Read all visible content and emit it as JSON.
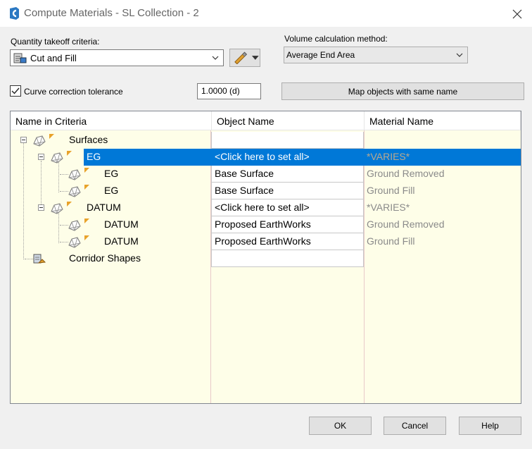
{
  "window": {
    "title": "Compute Materials - SL Collection - 2",
    "app_icon": "civil3d-logo-icon",
    "close_icon": "close-icon"
  },
  "criteria": {
    "label": "Quantity takeoff criteria:",
    "value": "Cut and Fill",
    "edit_icon": "edit-criteria-icon"
  },
  "volume": {
    "label": "Volume calculation method:",
    "value": "Average End Area"
  },
  "curve": {
    "label": "Curve correction tolerance",
    "checked": true,
    "value": "1.0000 (d)"
  },
  "map_button": "Map objects with same name",
  "grid": {
    "headers": [
      "Name in Criteria",
      "Object Name",
      "Material Name"
    ],
    "rows": [
      {
        "name": "Surfaces",
        "object": "",
        "material": ""
      },
      {
        "name": "EG",
        "object": "<Click here to set all>",
        "material": "*VARIES*"
      },
      {
        "name": "EG",
        "object": "Base Surface",
        "material": "Ground Removed"
      },
      {
        "name": "EG",
        "object": "Base Surface",
        "material": "Ground Fill"
      },
      {
        "name": "DATUM",
        "object": "<Click here to set all>",
        "material": "*VARIES*"
      },
      {
        "name": "DATUM",
        "object": "Proposed EarthWorks",
        "material": "Ground Removed"
      },
      {
        "name": "DATUM",
        "object": "Proposed EarthWorks",
        "material": "Ground Fill"
      },
      {
        "name": "Corridor Shapes",
        "object": "",
        "material": ""
      }
    ]
  },
  "buttons": {
    "ok": "OK",
    "cancel": "Cancel",
    "help": "Help"
  },
  "colors": {
    "selection": "#0078d7",
    "grid_background": "#fefee8"
  }
}
